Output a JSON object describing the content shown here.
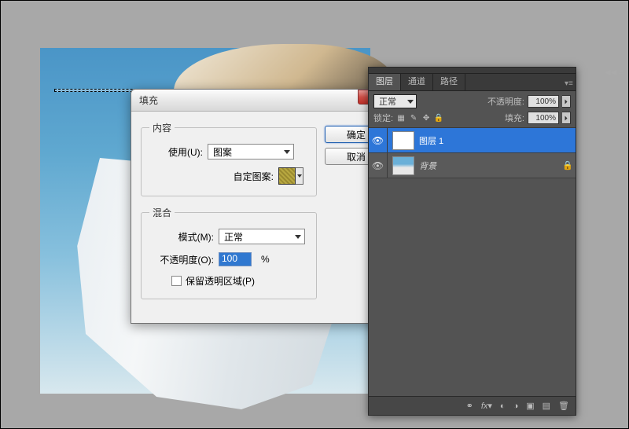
{
  "dialog": {
    "title": "填充",
    "content_legend": "内容",
    "use_label": "使用(U):",
    "use_value": "图案",
    "custom_pattern_label": "自定图案:",
    "blend_legend": "混合",
    "mode_label": "模式(M):",
    "mode_value": "正常",
    "opacity_label": "不透明度(O):",
    "opacity_value": "100",
    "opacity_unit": "%",
    "preserve_label": "保留透明区域(P)",
    "ok": "确定",
    "cancel": "取消"
  },
  "panel": {
    "tabs": {
      "layers": "图层",
      "channels": "通道",
      "paths": "路径"
    },
    "blend_mode": "正常",
    "opacity_label": "不透明度:",
    "opacity_value": "100%",
    "lock_label": "锁定:",
    "fill_label": "填充:",
    "fill_value": "100%",
    "layers_list": [
      {
        "name": "图层 1",
        "visible": true,
        "selected": true,
        "locked": false
      },
      {
        "name": "背景",
        "visible": true,
        "selected": false,
        "locked": true
      }
    ]
  }
}
